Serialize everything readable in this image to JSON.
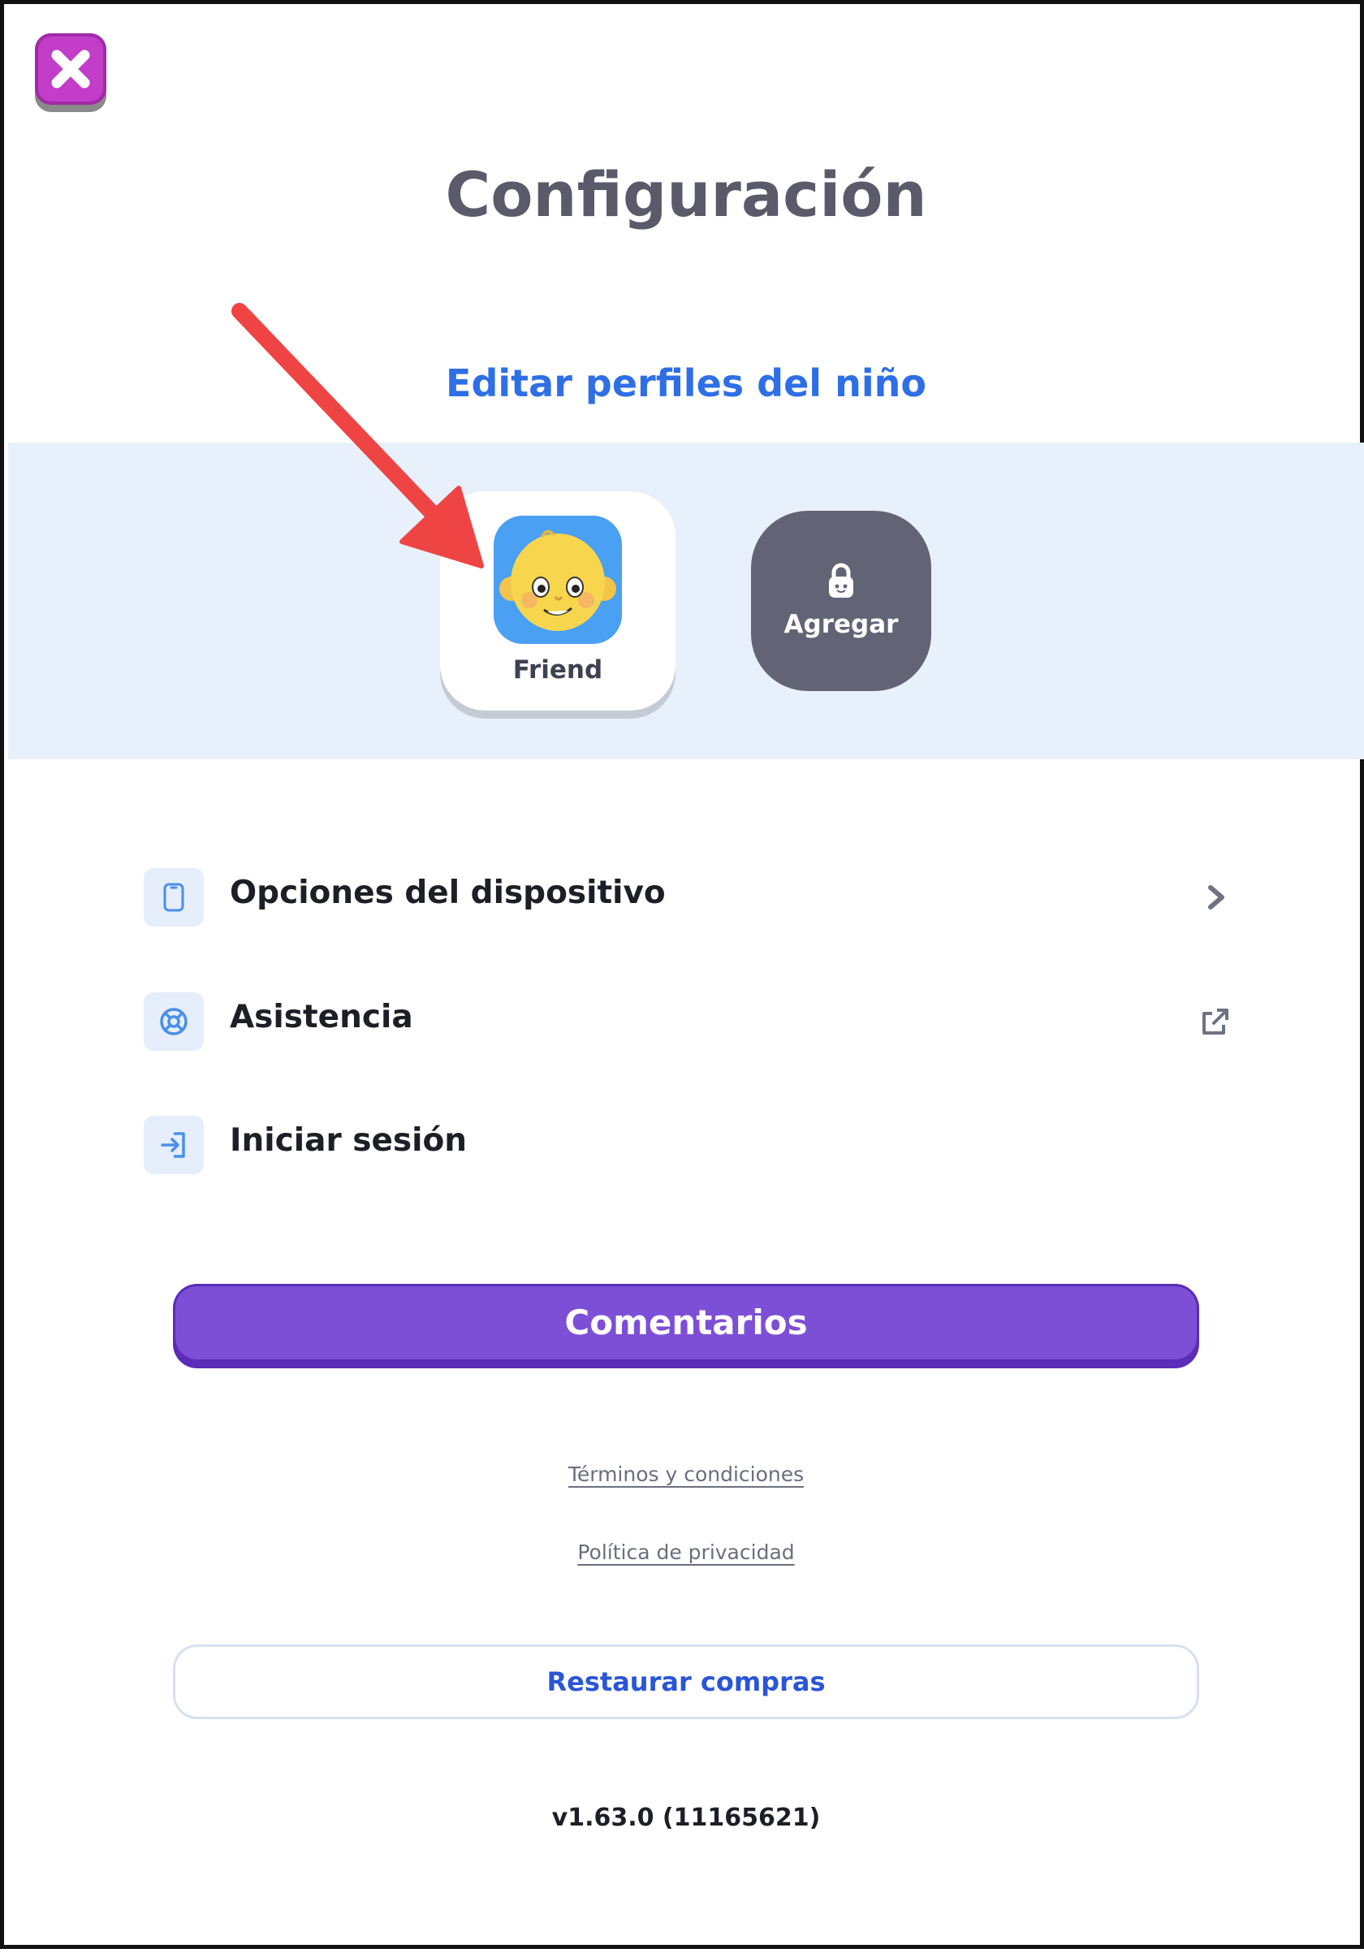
{
  "header": {
    "close_icon": "close-x-icon",
    "title": "Configuración"
  },
  "profiles": {
    "edit_link": "Editar perfiles del niño",
    "items": [
      {
        "name": "Friend",
        "avatar_icon": "child-face-avatar"
      }
    ],
    "add": {
      "label": "Agregar",
      "icon": "lock-icon"
    }
  },
  "menu": {
    "items": [
      {
        "label": "Opciones del dispositivo",
        "icon": "phone-icon",
        "trail_icon": "chevron-right-icon"
      },
      {
        "label": "Asistencia",
        "icon": "lifebuoy-icon",
        "trail_icon": "external-link-icon"
      },
      {
        "label": "Iniciar sesión",
        "icon": "sign-in-icon"
      }
    ]
  },
  "feedback_button": "Comentarios",
  "links": {
    "terms": "Términos y condiciones",
    "privacy": "Política de privacidad"
  },
  "restore_button": "Restaurar compras",
  "version": "v1.63.0 (11165621)",
  "colors": {
    "accent_blue": "#2f6fe6",
    "purple": "#7d4fd6",
    "close_magenta": "#c23ec9",
    "band": "#e8f0fb",
    "add_card": "#626476",
    "annotation_arrow": "#ef4444"
  }
}
